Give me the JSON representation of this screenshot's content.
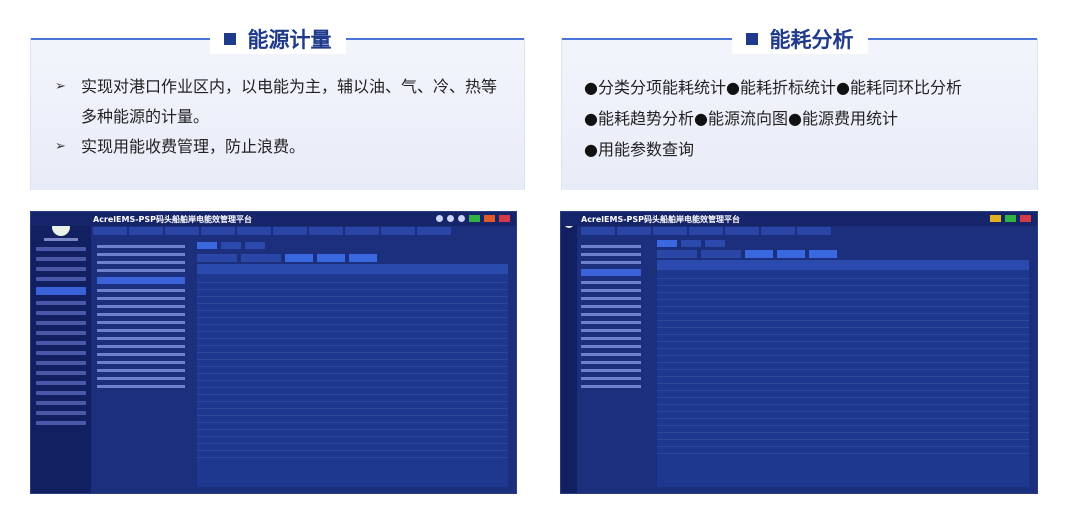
{
  "left_panel": {
    "title": "能源计量",
    "items": [
      "实现对港口作业区内，以电能为主，辅以油、气、冷、热等多种能源的计量。",
      "实现用能收费管理，防止浪费。"
    ]
  },
  "right_panel": {
    "title": "能耗分析",
    "features": [
      "分类分项能耗统计",
      "能耗折标统计",
      "能耗同环比分析",
      "能耗趋势分析",
      "能源流向图",
      "能源费用统计",
      "用能参数查询"
    ],
    "bullet_glyph": "●"
  },
  "screenshots": {
    "left_title": "AcrelEMS-PSP码头船舶岸电能效管理平台",
    "right_title": "AcrelEMS-PSP码头船舶岸电能效管理平台"
  },
  "colors": {
    "accent": "#1f3a8a",
    "line": "#4a74d8",
    "app_bg": "#1b2f7c"
  }
}
